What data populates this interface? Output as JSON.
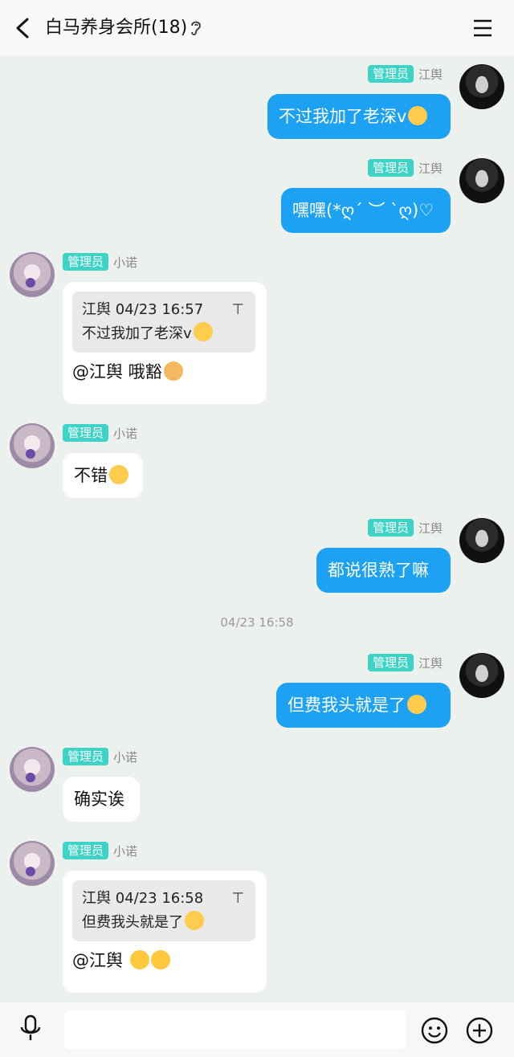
{
  "header": {
    "title": "白马养身会所(18)"
  },
  "timestamp": "04/23 16:58",
  "messages": [
    {
      "role": "管理员",
      "name": "江舆",
      "text": "不过我加了老深v"
    },
    {
      "role": "管理员",
      "name": "江舆",
      "text": "嘿嘿(*ღ´ ︶ `ღ)♡"
    },
    {
      "role": "管理员",
      "name": "小诺",
      "quote": {
        "author_time": "江舆 04/23 16:57",
        "text": "不过我加了老深v"
      },
      "text": "@江舆 哦豁"
    },
    {
      "role": "管理员",
      "name": "小诺",
      "text": "不错"
    },
    {
      "role": "管理员",
      "name": "江舆",
      "text": "都说很熟了嘛"
    },
    {
      "role": "管理员",
      "name": "江舆",
      "text": "但费我头就是了"
    },
    {
      "role": "管理员",
      "name": "小诺",
      "text": "确实诶"
    },
    {
      "role": "管理员",
      "name": "小诺",
      "quote": {
        "author_time": "江舆 04/23 16:58",
        "text": "但费我头就是了"
      },
      "text": "@江舆"
    }
  ],
  "icons": {
    "back": "chevron-left-icon",
    "ear": "ear-icon",
    "menu": "menu-icon",
    "mic": "microphone-icon",
    "emoji": "smile-icon",
    "add": "plus-icon"
  },
  "colors": {
    "bubble_self": "#1da1f2",
    "badge": "#3ed3c7",
    "background": "#edf1ee"
  }
}
